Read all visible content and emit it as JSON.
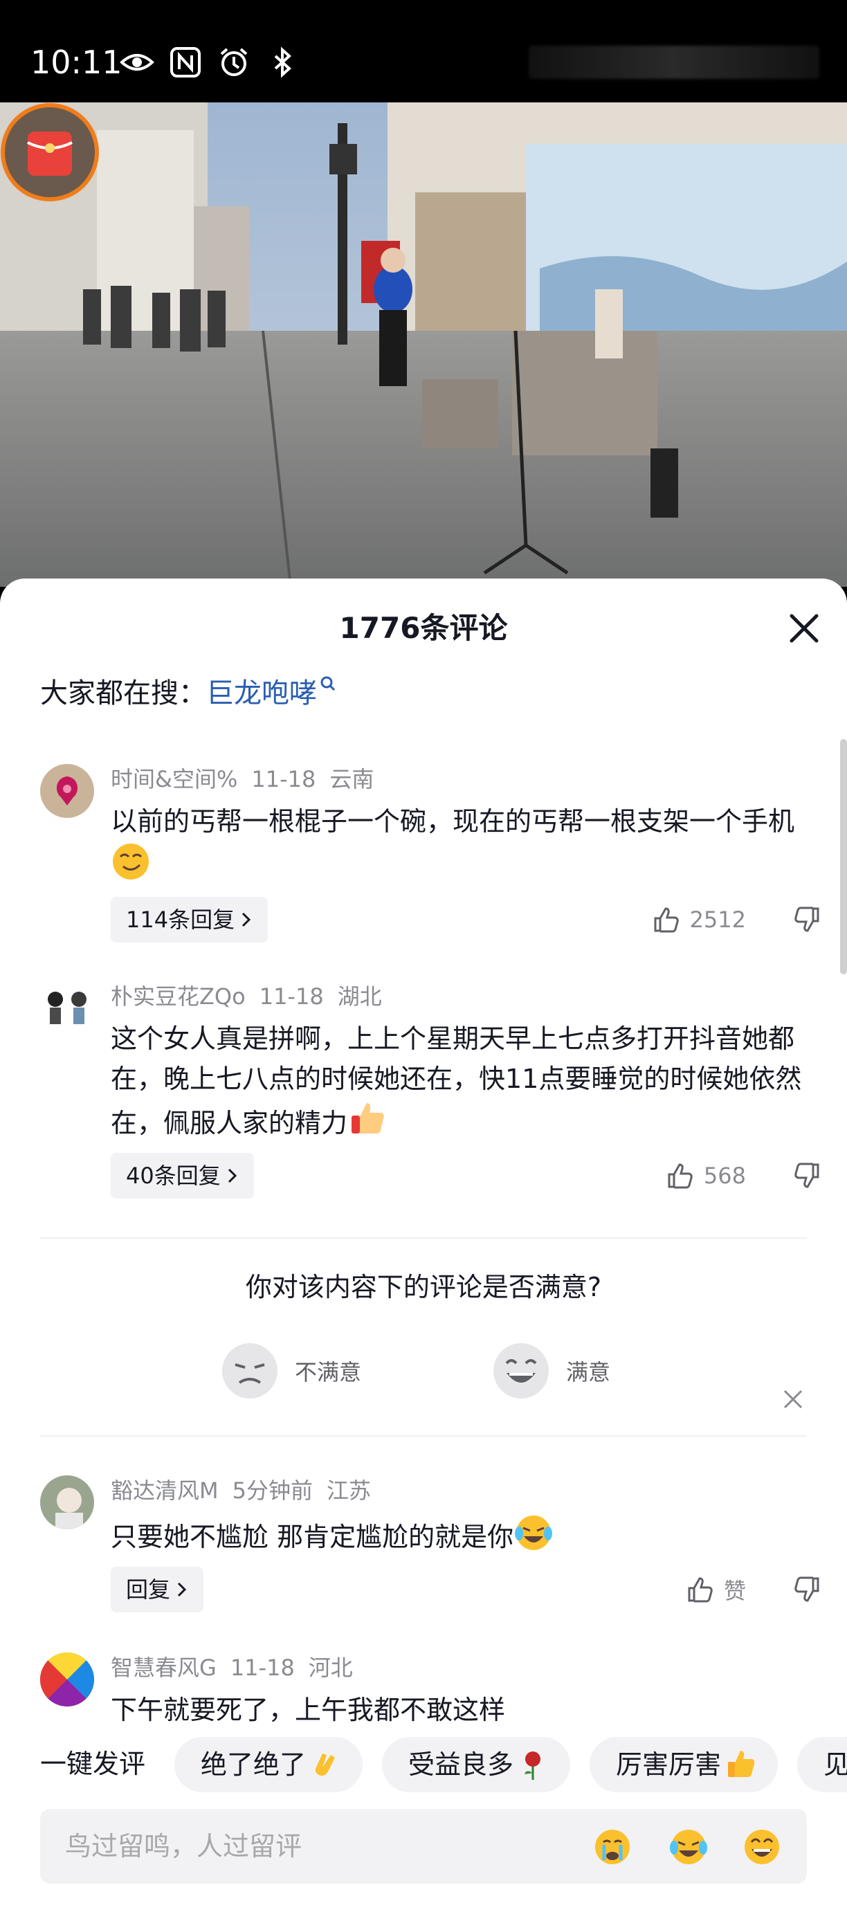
{
  "status_bar": {
    "time": "10:11"
  },
  "panel": {
    "title": "1776条评论"
  },
  "search": {
    "prefix": "大家都在搜：",
    "term": "巨龙咆哮"
  },
  "comments": [
    {
      "user": "时间&空间%",
      "date": "11-18",
      "location": "云南",
      "text": "以前的丐帮一根棍子一个碗，现在的丐帮一根支架一个手机",
      "emoji": "smirk-face",
      "replies": "114条回复",
      "likes": "2512"
    },
    {
      "user": "朴实豆花ZQo",
      "date": "11-18",
      "location": "湖北",
      "text": "这个女人真是拼啊，上上个星期天早上七点多打开抖音她都在，晚上七八点的时候她还在，快11点要睡觉的时候她依然在，佩服人家的精力",
      "emoji": "thumbs-up",
      "replies": "40条回复",
      "likes": "568"
    },
    {
      "user": "豁达清风M",
      "date": "5分钟前",
      "location": "江苏",
      "text": "只要她不尴尬 那肯定尴尬的就是你",
      "emoji": "laughing-tears-face",
      "replies": "回复",
      "likes": "赞"
    },
    {
      "user": "智慧春风G",
      "date": "11-18",
      "location": "河北",
      "text": "下午就要死了，上午我都不敢这样"
    }
  ],
  "survey": {
    "question": "你对该内容下的评论是否满意?",
    "negative": "不满意",
    "positive": "满意"
  },
  "quick_comment": {
    "label": "一键发评",
    "chips": [
      {
        "text": "绝了绝了",
        "emoji": "clapping-hands"
      },
      {
        "text": "受益良多",
        "emoji": "rose"
      },
      {
        "text": "厉害厉害",
        "emoji": "thumbs-up"
      },
      {
        "text": "见"
      }
    ]
  },
  "input": {
    "placeholder": "鸟过留鸣，人过留评",
    "emojis": [
      "crying-face",
      "laughing-tears-face",
      "grinning-face"
    ]
  },
  "colors": {
    "link": "#2a5db0",
    "text": "#161823",
    "muted": "#8a8b91",
    "chip_bg": "#f2f2f4"
  }
}
